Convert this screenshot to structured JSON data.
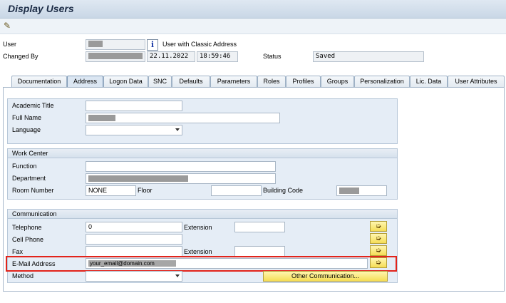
{
  "window": {
    "title": "Display Users"
  },
  "toolbar": {
    "icon": "pencil-glasses-icon"
  },
  "header": {
    "user_label": "User",
    "info_icon": "i",
    "user_type": "User with Classic Address",
    "changed_by_label": "Changed By",
    "date": "22.11.2022",
    "time": "18:59:46",
    "status_label": "Status",
    "status_value": "Saved"
  },
  "tabs": [
    "Documentation",
    "Address",
    "Logon Data",
    "SNC",
    "Defaults",
    "Parameters",
    "Roles",
    "Profiles",
    "Groups",
    "Personalization",
    "Lic. Data",
    "User Attributes"
  ],
  "person": {
    "academic_title_label": "Academic Title",
    "full_name_label": "Full Name",
    "language_label": "Language"
  },
  "work_center": {
    "title": "Work Center",
    "function_label": "Function",
    "department_label": "Department",
    "room_number_label": "Room Number",
    "room_number_value": "NONE",
    "floor_label": "Floor",
    "building_code_label": "Building Code"
  },
  "communication": {
    "title": "Communication",
    "telephone_label": "Telephone",
    "telephone_value": "0",
    "extension_label": "Extension",
    "cell_phone_label": "Cell Phone",
    "fax_label": "Fax",
    "fax_extension_label": "Extension",
    "email_label": "E-Mail Address",
    "email_value": "your_email@domain.com",
    "method_label": "Method",
    "other_comm_button": "Other Communication...",
    "arrow_glyph": "➭"
  },
  "colors": {
    "highlight": "#e2231a",
    "button_yellow": "#f5dd55"
  }
}
